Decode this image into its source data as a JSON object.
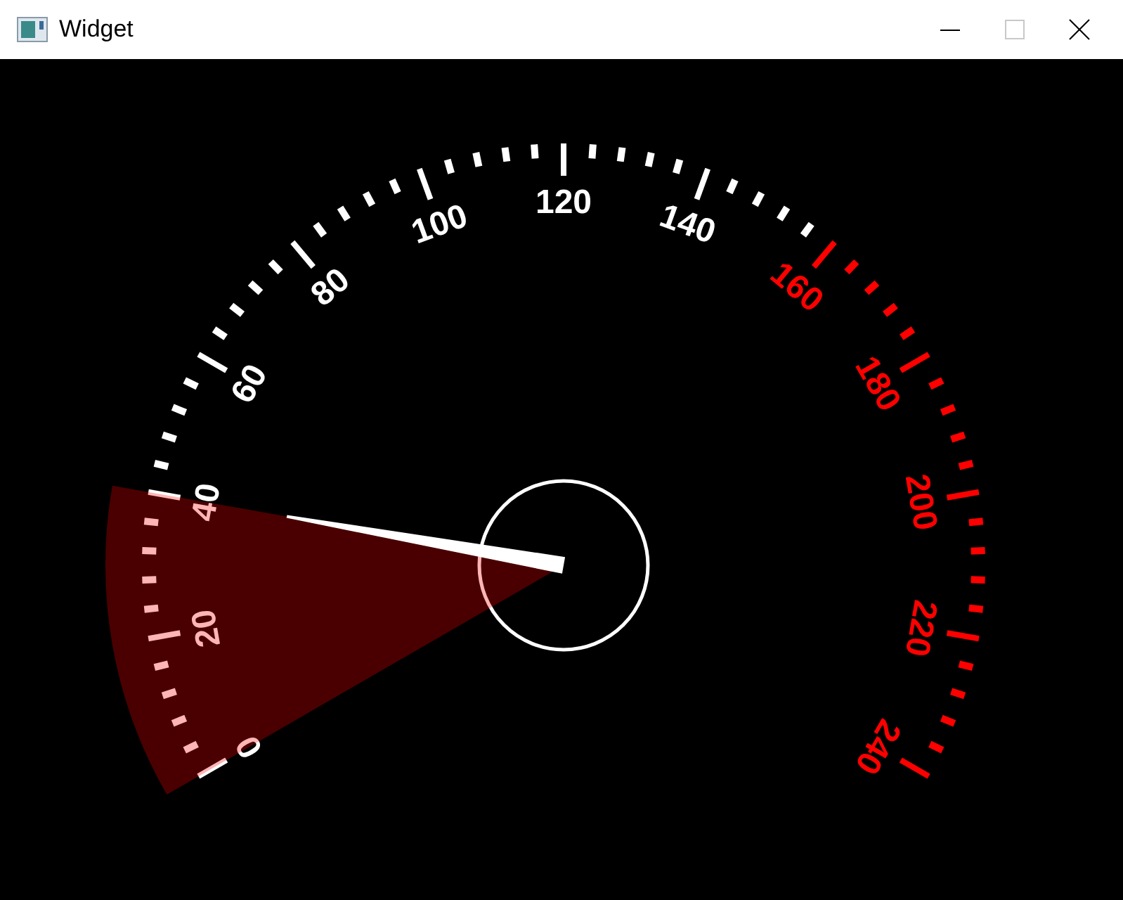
{
  "window": {
    "title": "Widget"
  },
  "gauge": {
    "level": 0.1667,
    "labels": [
      {
        "text": "0",
        "kind": "normal"
      },
      {
        "text": "20",
        "kind": "normal"
      },
      {
        "text": "40",
        "kind": "normal"
      },
      {
        "text": "60",
        "kind": "normal"
      },
      {
        "text": "80",
        "kind": "normal"
      },
      {
        "text": "100",
        "kind": "normal"
      },
      {
        "text": "120",
        "kind": "normal"
      },
      {
        "text": "140",
        "kind": "normal"
      },
      {
        "text": "160",
        "kind": "redline"
      },
      {
        "text": "180",
        "kind": "redline"
      },
      {
        "text": "200",
        "kind": "redline"
      },
      {
        "text": "220",
        "kind": "redline"
      },
      {
        "text": "240",
        "kind": "redline"
      }
    ]
  }
}
